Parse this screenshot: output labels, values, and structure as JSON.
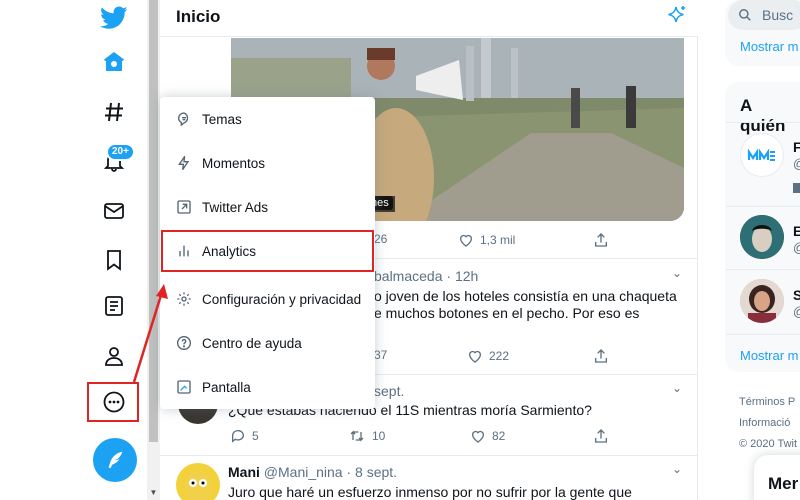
{
  "header": {
    "title": "Inicio"
  },
  "nav": {
    "notifications_badge": "20+",
    "icons": [
      "twitter-logo",
      "home-icon",
      "hashtag-icon",
      "bell-icon",
      "mail-icon",
      "bookmark-icon",
      "list-icon",
      "profile-icon",
      "more-icon"
    ]
  },
  "video": {
    "caption_fragment": "nes"
  },
  "tweets": [
    {
      "replies": "",
      "retweets": "26",
      "likes": "1,3 mil"
    },
    {
      "handle_fragment": "balmaceda",
      "time": "12h",
      "text_line1": "o joven de los hoteles consistía en una chaqueta",
      "text_line2": "e muchos botones en el pecho. Por eso es",
      "retweets": "37",
      "likes": "222"
    },
    {
      "date_fragment": "sept.",
      "text": "¿Qué estabas haciendo el 11S mientras moría Sarmiento?",
      "replies": "5",
      "retweets": "10",
      "likes": "82"
    },
    {
      "name": "Mani",
      "handle": "@Mani_nina",
      "date": "· 8 sept.",
      "text": "Juro que haré un esfuerzo inmenso por no sufrir por la gente que"
    }
  ],
  "menu": {
    "items": [
      {
        "label": "Temas",
        "icon": "topics-icon"
      },
      {
        "label": "Momentos",
        "icon": "lightning-icon"
      },
      {
        "label": "Twitter Ads",
        "icon": "external-arrow-icon"
      },
      {
        "label": "Analytics",
        "icon": "bar-chart-icon"
      },
      {
        "label": "Configuración y privacidad",
        "icon": "gear-icon"
      },
      {
        "label": "Centro de ayuda",
        "icon": "help-icon"
      },
      {
        "label": "Pantalla",
        "icon": "display-icon"
      }
    ]
  },
  "right": {
    "search_placeholder": "Busc",
    "show_more_1": "Mostrar m",
    "who_to_follow": "A quién",
    "accounts": [
      {
        "initial": "F",
        "handle": "@"
      },
      {
        "initial": "E",
        "handle": "@"
      },
      {
        "initial": "S",
        "handle": "@"
      }
    ],
    "show_more_2": "Mostrar m",
    "footer": [
      "Términos  P",
      "Informació",
      "© 2020 Twit"
    ],
    "messages_fragment": "Mer"
  },
  "colors": {
    "accent": "#1da1f2",
    "highlight": "#e02424"
  }
}
